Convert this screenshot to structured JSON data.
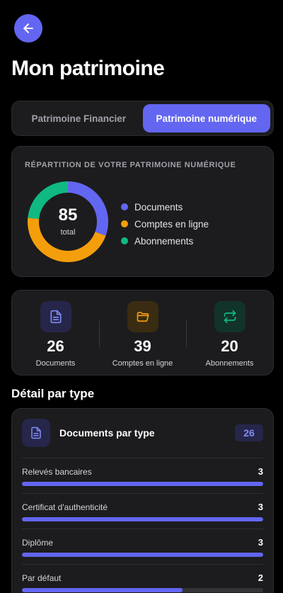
{
  "header": {
    "title": "Mon patrimoine"
  },
  "tabs": [
    {
      "label": "Patrimoine Financier",
      "active": false
    },
    {
      "label": "Patrimoine numérique",
      "active": true
    }
  ],
  "distribution": {
    "overline": "RÉPARTITION DE VOTRE PATRIMOINE NUMÉRIQUE",
    "total": "85",
    "total_caption": "total",
    "legend": [
      {
        "label": "Documents",
        "value": 26,
        "color": "#6366f1"
      },
      {
        "label": "Comptes en ligne",
        "value": 39,
        "color": "#f59e0b"
      },
      {
        "label": "Abonnements",
        "value": 20,
        "color": "#10b981"
      }
    ]
  },
  "stats": [
    {
      "value": "26",
      "label": "Documents",
      "icon": "document-icon",
      "color": "#6366f1",
      "bg": "#26264a"
    },
    {
      "value": "39",
      "label": "Comptes en ligne",
      "icon": "folder-icon",
      "color": "#f59e0b",
      "bg": "#3a2c12"
    },
    {
      "value": "20",
      "label": "Abonnements",
      "icon": "repeat-icon",
      "color": "#10b981",
      "bg": "#12332a"
    }
  ],
  "detail": {
    "section_title": "Détail par type",
    "title": "Documents par type",
    "badge": "26",
    "max": 3,
    "rows": [
      {
        "label": "Relevés bancaires",
        "count": 3
      },
      {
        "label": "Certificat d'authenticité",
        "count": 3
      },
      {
        "label": "Diplôme",
        "count": 3
      },
      {
        "label": "Par défaut",
        "count": 2
      }
    ]
  }
}
